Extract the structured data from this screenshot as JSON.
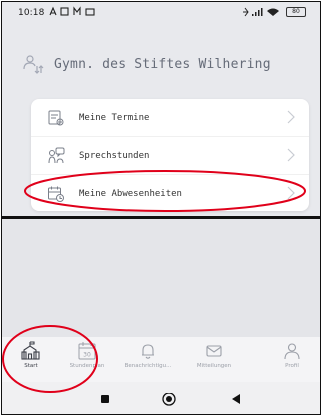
{
  "status_bar": {
    "time": "10:18",
    "battery": "80"
  },
  "header": {
    "title": "Gymn. des Stiftes Wilhering"
  },
  "menu": {
    "items": [
      {
        "label": "Meine Termine",
        "icon": "calendar-clipboard-icon"
      },
      {
        "label": "Sprechstunden",
        "icon": "people-chat-icon"
      },
      {
        "label": "Meine Abwesenheiten",
        "icon": "calendar-clock-icon"
      }
    ]
  },
  "nav": {
    "items": [
      {
        "label": "Start",
        "icon": "school-building-icon",
        "active": true
      },
      {
        "label": "Stundenplan",
        "icon": "timetable-icon",
        "day": "30"
      },
      {
        "label": "Benachrichtigu...",
        "icon": "bell-icon"
      },
      {
        "label": "Mitteilungen",
        "icon": "envelope-icon"
      },
      {
        "label": "Profil",
        "icon": "person-icon"
      }
    ]
  },
  "colors": {
    "annotation": "#e0001a",
    "background": "#e8e9ed",
    "card": "#ffffff"
  }
}
